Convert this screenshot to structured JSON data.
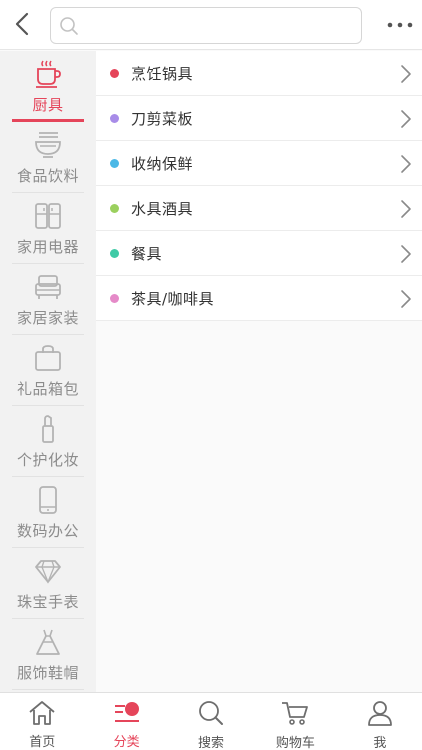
{
  "colors": {
    "accent": "#e5455a",
    "inactive_icon": "#b3b3b3",
    "nav_icon": "#6e6e6e"
  },
  "header": {
    "back_icon": "chevron-left-icon",
    "search_placeholder": "",
    "search_value": "",
    "more_icon": "more-horizontal-icon"
  },
  "sidebar": {
    "items": [
      {
        "label": "厨具",
        "icon": "teacup-icon",
        "active": true
      },
      {
        "label": "食品饮料",
        "icon": "noodle-bowl-icon"
      },
      {
        "label": "家用电器",
        "icon": "refrigerator-icon"
      },
      {
        "label": "家居家装",
        "icon": "sofa-icon"
      },
      {
        "label": "礼品箱包",
        "icon": "handbag-icon"
      },
      {
        "label": "个护化妆",
        "icon": "lipstick-icon"
      },
      {
        "label": "数码办公",
        "icon": "phone-icon"
      },
      {
        "label": "珠宝手表",
        "icon": "diamond-icon"
      },
      {
        "label": "服饰鞋帽",
        "icon": "dress-icon"
      }
    ]
  },
  "content": {
    "subcategories": [
      {
        "label": "烹饪锅具",
        "color": "#e5455a"
      },
      {
        "label": "刀剪菜板",
        "color": "#a88ce8"
      },
      {
        "label": "收纳保鲜",
        "color": "#4bb8e6"
      },
      {
        "label": "水具酒具",
        "color": "#9bd05e"
      },
      {
        "label": "餐具",
        "color": "#3fcaa6"
      },
      {
        "label": "茶具/咖啡具",
        "color": "#e58ac8"
      }
    ]
  },
  "bottom_nav": {
    "items": [
      {
        "label": "首页",
        "icon": "home-icon"
      },
      {
        "label": "分类",
        "icon": "category-icon",
        "active": true
      },
      {
        "label": "搜索",
        "icon": "search-icon"
      },
      {
        "label": "购物车",
        "icon": "cart-icon"
      },
      {
        "label": "我",
        "icon": "user-icon"
      }
    ]
  }
}
